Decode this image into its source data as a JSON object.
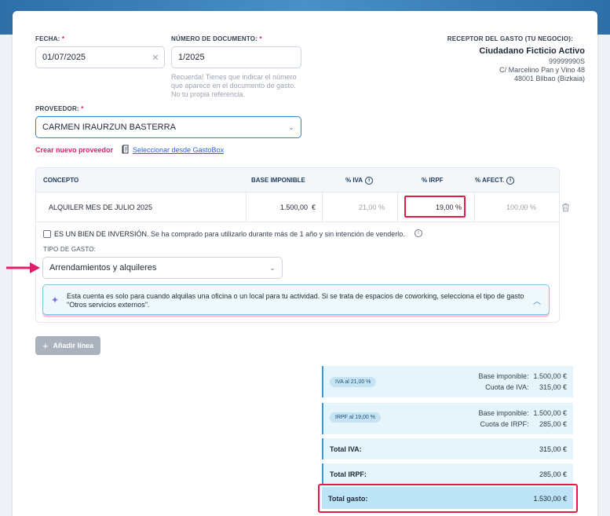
{
  "form": {
    "fecha_label": "FECHA:",
    "req_mark": "*",
    "fecha_value": "01/07/2025",
    "doc_label": "NÚMERO DE DOCUMENTO:",
    "doc_value": "1/2025",
    "doc_hint": "Recuerda! Tienes que indicar el número que aparece en el documento de gasto. No tu propia referencia.",
    "proveedor_label": "PROVEEDOR:",
    "proveedor_value": "CARMEN IRAURZUN BASTERRA",
    "crear_link": "Crear nuevo proveedor",
    "gastobox_link": "Seleccionar desde GastoBox"
  },
  "receptor": {
    "label": "RECEPTOR DEL GASTO (TU NEGOCIO):",
    "name": "Ciudadano Ficticio Activo",
    "nif": "99999990S",
    "address1": "C/ Marcelino Pan y Vino 48",
    "address2": "48001 Bilbao (Bizkaia)"
  },
  "table": {
    "headers": {
      "concepto": "CONCEPTO",
      "base": "BASE IMPONIBLE",
      "iva": "% IVA",
      "irpf": "% IRPF",
      "afect": "% AFECT."
    },
    "row": {
      "concepto": "ALQUILER MES DE JULIO 2025",
      "base": "1.500,00",
      "currency": "€",
      "iva": "21,00 %",
      "irpf": "19,00 %",
      "afect": "100,00 %"
    },
    "inversion_title": "ES UN BIEN DE INVERSIÓN.",
    "inversion_text": "Se ha comprado para utilizarlo durante más de 1 año y sin intención de venderlo.",
    "tipo_label": "TIPO DE GASTO:",
    "tipo_value": "Arrendamientos y alquileres",
    "notice": "Esta cuenta es solo para cuando alquilas una oficina o un local para tu actividad. Si se trata de espacios de coworking, selecciona el tipo de gasto \"Otros servicios externos\"."
  },
  "add_line": "Añadir línea",
  "summary": {
    "iva_pill": "IVA al 21,00 %",
    "irpf_pill": "IRPF al 19,00 %",
    "base_label": "Base imponible:",
    "cuota_iva_label": "Cuota de IVA:",
    "cuota_irpf_label": "Cuota de IRPF:",
    "iva_base": "1.500,00 €",
    "iva_cuota": "315,00 €",
    "irpf_base": "1.500,00 €",
    "irpf_cuota": "285,00 €",
    "total_iva_label": "Total IVA:",
    "total_iva": "315,00 €",
    "total_irpf_label": "Total IRPF:",
    "total_irpf": "285,00 €",
    "total_gasto_label": "Total gasto:",
    "total_gasto": "1.530,00 €"
  },
  "colors": {
    "accent": "#3b82c4",
    "highlight": "#e11d48",
    "pink": "#e11d6b"
  }
}
